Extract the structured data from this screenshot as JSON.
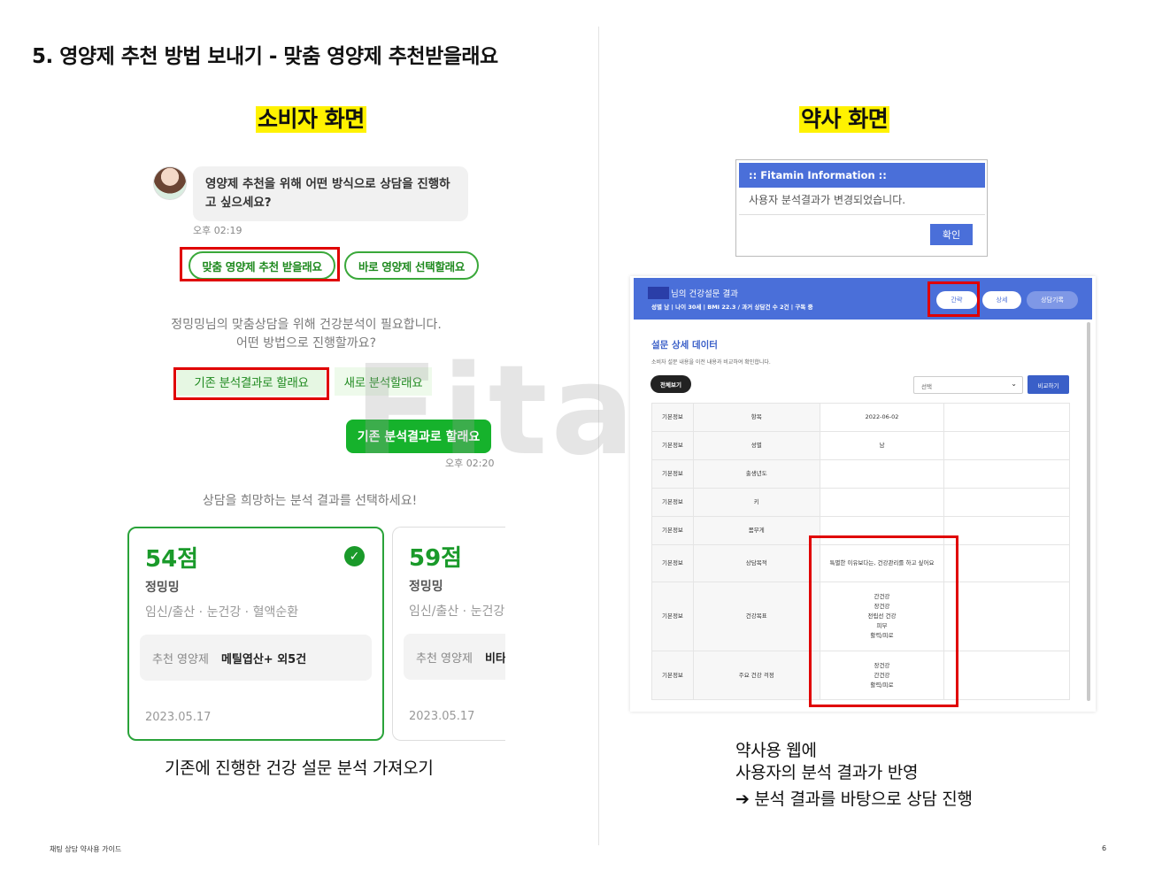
{
  "page_title": "5. 영양제 추천 방법 보내기 - 맞춤 영양제 추천받을래요",
  "consumer": {
    "heading": "소비자 화면",
    "bubble_text": "영양제 추천을 위해 어떤 방식으로 상담을 진행하고 싶으세요?",
    "time1": "오후 02:19",
    "choice_custom": "맞춤 영양제 추천 받을래요",
    "choice_direct": "바로 영양제 선택할래요",
    "system_message": "정밍밍님의 맞춤상담을 위해 건강분석이 필요합니다. 어떤 방법으로 진행할까요?",
    "choice_existing": "기존 분석결과로 할래요",
    "choice_new": "새로 분석할래요",
    "sent_message": "기존 분석결과로 할래요",
    "time2": "오후 02:20",
    "select_prompt": "상담을 희망하는 분석 결과를 선택하세요!",
    "cards": [
      {
        "score": "54점",
        "name": "정밍밍",
        "categories": "임신/출산 · 눈건강 · 혈액순환",
        "rec_label": "추천 영양제",
        "rec_value": "메틸엽산+ 외5건",
        "date": "2023.05.17"
      },
      {
        "score": "59점",
        "name": "정밍밍",
        "categories": "임신/출산 · 눈건강 ·",
        "rec_label": "추천 영양제",
        "rec_value": "비타",
        "date": "2023.05.17"
      }
    ],
    "caption": "기존에 진행한 건강 설문 분석 가져오기"
  },
  "watermark": "Fitamin",
  "pharmacist": {
    "heading": "약사 화면",
    "dialog": {
      "title": ":: Fitamin Information ::",
      "message": "사용자 분석결과가 변경되었습니다.",
      "ok": "확인"
    },
    "web": {
      "title": "님의 건강설문 결과",
      "subtitle": "성별 남 | 나이 30세 | BMI 22.3    / 과거 상담건 수 2건 | 구독 중",
      "btn_simple": "간략",
      "btn_detail": "상세",
      "btn_history": "상담기록",
      "section_title": "설문 상세 데이터",
      "section_sub": "소비자 설문 내용을 이전 내용과 비교하여 확인합니다.",
      "btn_all": "전체보기",
      "select_placeholder": "선택",
      "btn_compare": "비교하기",
      "rows": [
        {
          "cat": "기본정보",
          "item": "항목",
          "value": "2022-06-02"
        },
        {
          "cat": "기본정보",
          "item": "성별",
          "value": "남"
        },
        {
          "cat": "기본정보",
          "item": "출생년도",
          "value": ""
        },
        {
          "cat": "기본정보",
          "item": "키",
          "value": ""
        },
        {
          "cat": "기본정보",
          "item": "몸무게",
          "value": ""
        },
        {
          "cat": "기본정보",
          "item": "상담목적",
          "value": "특별한 이유보다는, 건강관리를 하고 싶어요"
        },
        {
          "cat": "기본정보",
          "item": "건강목표",
          "value": "간건강\n장건강\n전립선 건강\n피부\n활력/피로"
        },
        {
          "cat": "기본정보",
          "item": "주요 건강 걱정",
          "value": "장건강\n간건강\n활력/피로"
        }
      ]
    },
    "caption_line1": "약사용 웹에",
    "caption_line2": "사용자의 분석 결과가 반영",
    "caption_line3": "➔ 분석 결과를 바탕으로 상담 진행"
  },
  "footer": {
    "left": "채팅 상담 약사용 가이드",
    "page": "6"
  },
  "colors": {
    "highlight": "#fff200",
    "green": "#16b22c",
    "red_box": "#e00000",
    "blue": "#4a6fd9"
  }
}
